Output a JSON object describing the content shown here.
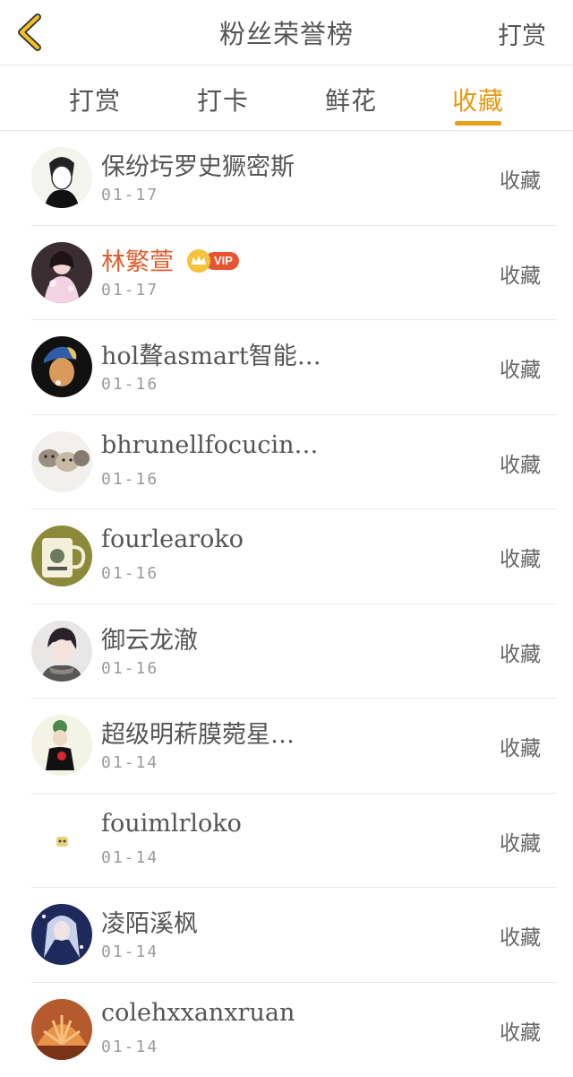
{
  "header": {
    "title": "粉丝荣誉榜",
    "right_label": "打赏"
  },
  "tabs": [
    {
      "label": "打赏",
      "active": false
    },
    {
      "label": "打卡",
      "active": false
    },
    {
      "label": "鲜花",
      "active": false
    },
    {
      "label": "收藏",
      "active": true
    }
  ],
  "colors": {
    "accent": "#e69a12",
    "vip_name": "#e25b2b",
    "vip_badge": "#e8542f"
  },
  "fans": [
    {
      "name": "保纷圬罗史獗密斯",
      "date": "01-17",
      "action": "收藏",
      "avatar": "avatar-sketch-icon"
    },
    {
      "name": "林繁萱",
      "date": "01-17",
      "action": "收藏",
      "vip": true,
      "vip_label": "VIP",
      "avatar": "avatar-girl-icon"
    },
    {
      "name": "hol聱asmart智能…",
      "date": "01-16",
      "action": "收藏",
      "avatar": "avatar-pearl-earring-icon"
    },
    {
      "name": "bhrunellfocucin…",
      "date": "01-16",
      "action": "收藏",
      "avatar": "avatar-cats-icon"
    },
    {
      "name": "fourlearoko",
      "date": "01-16",
      "action": "收藏",
      "avatar": "avatar-mug-icon"
    },
    {
      "name": "御云龙澈",
      "date": "01-16",
      "action": "收藏",
      "avatar": "avatar-anime-boy-icon"
    },
    {
      "name": "超级明菥膜菀星…",
      "date": "01-14",
      "action": "收藏",
      "avatar": "avatar-flower-icon"
    },
    {
      "name": "fouimlrloko",
      "date": "01-14",
      "action": "收藏",
      "avatar": "avatar-small-icon"
    },
    {
      "name": "凌陌溪枫",
      "date": "01-14",
      "action": "收藏",
      "avatar": "avatar-anime-girl-icon"
    },
    {
      "name": "colehxxanxruan",
      "date": "01-14",
      "action": "收藏",
      "avatar": "avatar-shell-icon"
    }
  ]
}
